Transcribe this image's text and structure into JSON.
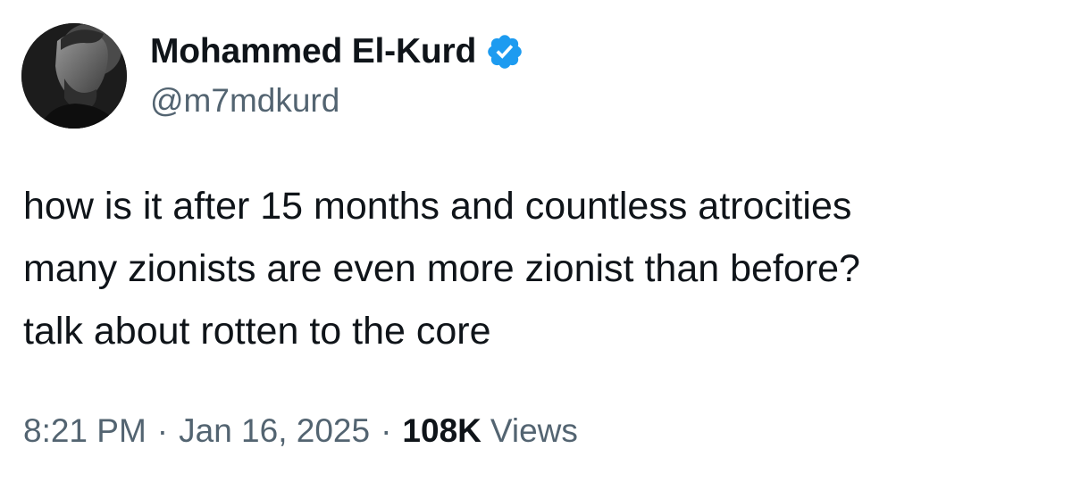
{
  "author": {
    "display_name": "Mohammed El-Kurd",
    "handle": "@m7mdkurd",
    "verified_icon": "verified-badge-icon",
    "verified_color": "#1d9bf0"
  },
  "tweet": {
    "lines": [
      "how is it after 15 months and countless atrocities",
      "many zionists are even more zionist than before?",
      "talk about rotten to the core"
    ]
  },
  "meta": {
    "time": "8:21 PM",
    "separator": "·",
    "date": "Jan 16, 2025",
    "views_count": "108K",
    "views_label": "Views"
  },
  "colors": {
    "text_primary": "#0f1419",
    "text_secondary": "#536471",
    "background": "#ffffff"
  }
}
